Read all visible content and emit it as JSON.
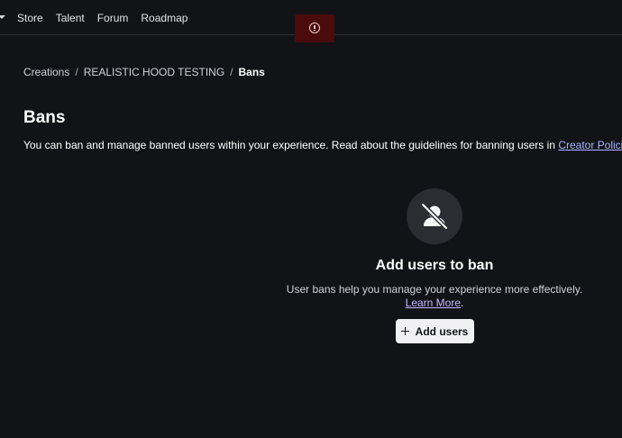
{
  "nav": {
    "items": [
      {
        "label": "Store"
      },
      {
        "label": "Talent"
      },
      {
        "label": "Forum"
      },
      {
        "label": "Roadmap"
      }
    ]
  },
  "alert": {
    "icon": "alert-circle-icon",
    "color": "#4a0b0d"
  },
  "breadcrumb": {
    "items": [
      "Creations",
      "REALISTIC HOOD TESTING"
    ],
    "separator": "/",
    "current": "Bans"
  },
  "page": {
    "title": "Bans",
    "description": "You can ban and manage banned users within your experience. Read about the guidelines for banning users in ",
    "description_link": "Creator Policies",
    "description_end": "."
  },
  "empty_state": {
    "icon": "user-banned-icon",
    "title": "Add users to ban",
    "description": "User bans help you manage your experience more effectively. ",
    "learn_more": "Learn More",
    "description_end": ".",
    "button_label": "Add users",
    "button_icon": "plus-icon"
  },
  "colors": {
    "background": "#121317",
    "link": "#a9b6ff",
    "button_bg": "#f1f1f3"
  }
}
